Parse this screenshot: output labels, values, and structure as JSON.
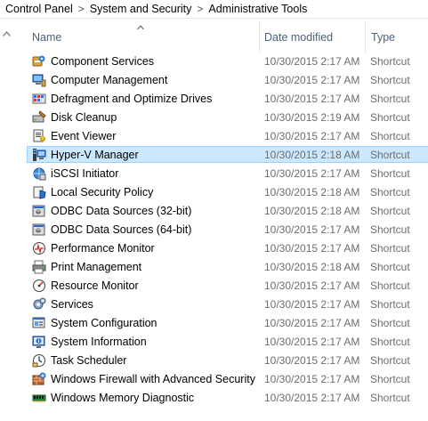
{
  "breadcrumb": {
    "items": [
      "Control Panel",
      "System and Security",
      "Administrative Tools"
    ],
    "separator": ">"
  },
  "columns": {
    "name": "Name",
    "date": "Date modified",
    "type": "Type"
  },
  "colors": {
    "selected_bg": "#cce8ff",
    "selected_border": "#99d1ff",
    "header_text": "#4c607a",
    "secondary_text": "#6d6d6d"
  },
  "files": [
    {
      "name": "Component Services",
      "date": "10/30/2015 2:17 AM",
      "type": "Shortcut",
      "icon": "component-services-icon"
    },
    {
      "name": "Computer Management",
      "date": "10/30/2015 2:17 AM",
      "type": "Shortcut",
      "icon": "computer-management-icon"
    },
    {
      "name": "Defragment and Optimize Drives",
      "date": "10/30/2015 2:17 AM",
      "type": "Shortcut",
      "icon": "defragment-icon"
    },
    {
      "name": "Disk Cleanup",
      "date": "10/30/2015 2:19 AM",
      "type": "Shortcut",
      "icon": "disk-cleanup-icon"
    },
    {
      "name": "Event Viewer",
      "date": "10/30/2015 2:17 AM",
      "type": "Shortcut",
      "icon": "event-viewer-icon"
    },
    {
      "name": "Hyper-V Manager",
      "date": "10/30/2015 2:18 AM",
      "type": "Shortcut",
      "icon": "hyper-v-icon",
      "selected": true
    },
    {
      "name": "iSCSI Initiator",
      "date": "10/30/2015 2:17 AM",
      "type": "Shortcut",
      "icon": "iscsi-icon"
    },
    {
      "name": "Local Security Policy",
      "date": "10/30/2015 2:18 AM",
      "type": "Shortcut",
      "icon": "security-policy-icon"
    },
    {
      "name": "ODBC Data Sources (32-bit)",
      "date": "10/30/2015 2:18 AM",
      "type": "Shortcut",
      "icon": "odbc-icon"
    },
    {
      "name": "ODBC Data Sources (64-bit)",
      "date": "10/30/2015 2:17 AM",
      "type": "Shortcut",
      "icon": "odbc-icon"
    },
    {
      "name": "Performance Monitor",
      "date": "10/30/2015 2:17 AM",
      "type": "Shortcut",
      "icon": "performance-monitor-icon"
    },
    {
      "name": "Print Management",
      "date": "10/30/2015 2:18 AM",
      "type": "Shortcut",
      "icon": "print-management-icon"
    },
    {
      "name": "Resource Monitor",
      "date": "10/30/2015 2:17 AM",
      "type": "Shortcut",
      "icon": "resource-monitor-icon"
    },
    {
      "name": "Services",
      "date": "10/30/2015 2:17 AM",
      "type": "Shortcut",
      "icon": "services-icon"
    },
    {
      "name": "System Configuration",
      "date": "10/30/2015 2:17 AM",
      "type": "Shortcut",
      "icon": "system-configuration-icon"
    },
    {
      "name": "System Information",
      "date": "10/30/2015 2:17 AM",
      "type": "Shortcut",
      "icon": "system-information-icon"
    },
    {
      "name": "Task Scheduler",
      "date": "10/30/2015 2:17 AM",
      "type": "Shortcut",
      "icon": "task-scheduler-icon"
    },
    {
      "name": "Windows Firewall with Advanced Security",
      "date": "10/30/2015 2:17 AM",
      "type": "Shortcut",
      "icon": "firewall-icon"
    },
    {
      "name": "Windows Memory Diagnostic",
      "date": "10/30/2015 2:17 AM",
      "type": "Shortcut",
      "icon": "memory-diagnostic-icon"
    }
  ]
}
